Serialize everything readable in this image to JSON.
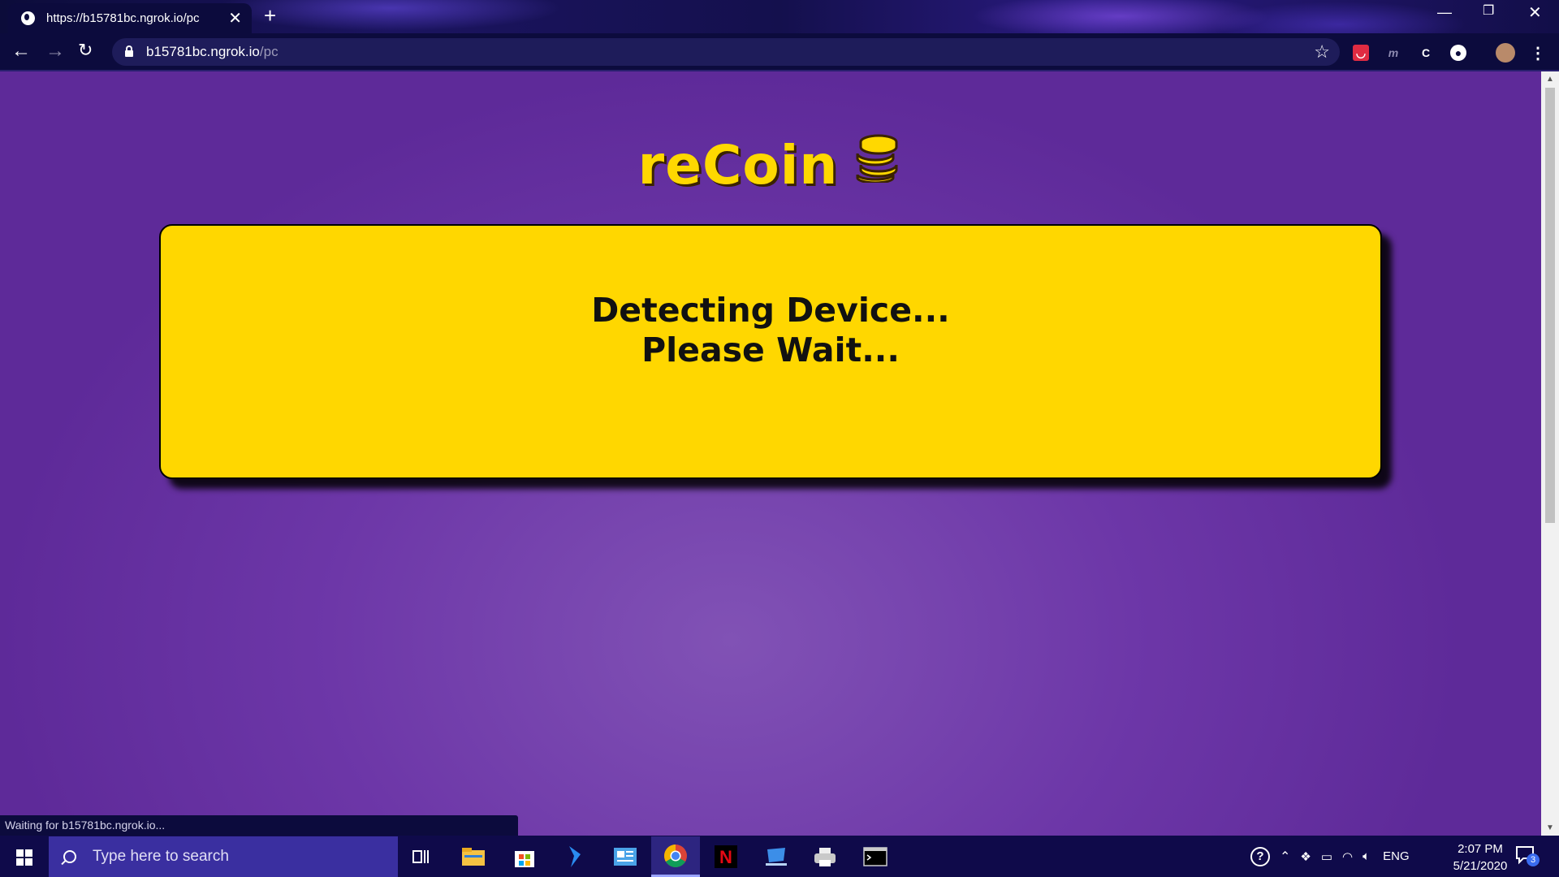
{
  "browser": {
    "tab_title": "https://b15781bc.ngrok.io/pc",
    "url_host": "b15781bc.ngrok.io",
    "url_path": "/pc",
    "status_text": "Waiting for b15781bc.ngrok.io..."
  },
  "page": {
    "logo_text": "reCoin",
    "message_line1": "Detecting Device...",
    "message_line2": "Please Wait...",
    "colors": {
      "background": "#6d37a8",
      "card": "#ffd700",
      "logo": "#ffd800"
    }
  },
  "taskbar": {
    "search_placeholder": "Type here to search",
    "language": "ENG",
    "time": "2:07 PM",
    "date": "5/21/2020",
    "notification_count": "3",
    "apps": [
      "task-view",
      "file-explorer",
      "microsoft-store",
      "visual-studio",
      "news-app",
      "chrome",
      "netflix",
      "remote-desktop",
      "printer-app",
      "terminal"
    ]
  }
}
